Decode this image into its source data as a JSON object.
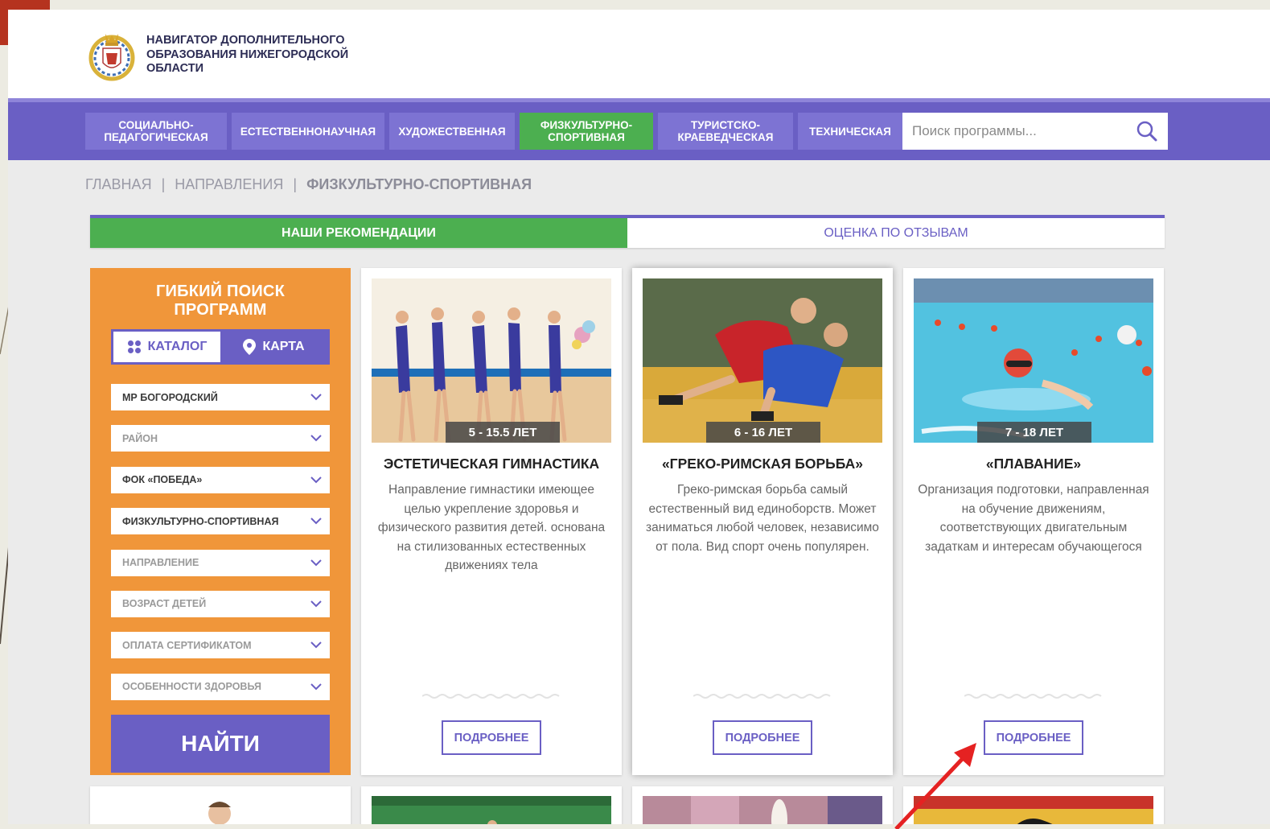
{
  "header": {
    "logo_text": "НАВИГАТОР ДОПОЛНИТЕЛЬНОГО ОБРАЗОВАНИЯ НИЖЕГОРОДСКОЙ ОБЛАСТИ"
  },
  "nav": {
    "tabs": [
      {
        "label": "СОЦИАЛЬНО-ПЕДАГОГИЧЕСКАЯ"
      },
      {
        "label": "ЕСТЕСТВЕННОНАУЧНАЯ"
      },
      {
        "label": "ХУДОЖЕСТВЕННАЯ"
      },
      {
        "label": "ФИЗКУЛЬТУРНО-СПОРТИВНАЯ"
      },
      {
        "label": "ТУРИСТСКО-КРАЕВЕДЧЕСКАЯ"
      },
      {
        "label": "ТЕХНИЧЕСКАЯ"
      }
    ],
    "active_index": 3,
    "search_placeholder": "Поиск программы..."
  },
  "breadcrumb": {
    "items": [
      "ГЛАВНАЯ",
      "НАПРАВЛЕНИЯ",
      "ФИЗКУЛЬТУРНО-СПОРТИВНАЯ"
    ],
    "separator": "|"
  },
  "rec_tabs": {
    "recommendations": "НАШИ РЕКОМЕНДАЦИИ",
    "reviews": "ОЦЕНКА ПО ОТЗЫВАМ"
  },
  "sidebar": {
    "title": "ГИБКИЙ ПОИСК ПРОГРАММ",
    "catalog_label": "КАТАЛОГ",
    "map_label": "КАРТА",
    "filters": [
      {
        "label": "МР БОГОРОДСКИЙ",
        "filled": true
      },
      {
        "label": "РАЙОН",
        "filled": false
      },
      {
        "label": "ФОК «ПОБЕДА»",
        "filled": true
      },
      {
        "label": "ФИЗКУЛЬТУРНО-СПОРТИВНАЯ",
        "filled": true
      },
      {
        "label": "НАПРАВЛЕНИЕ",
        "filled": false
      },
      {
        "label": "ВОЗРАСТ ДЕТЕЙ",
        "filled": false
      },
      {
        "label": "ОПЛАТА СЕРТИФИКАТОМ",
        "filled": false
      },
      {
        "label": "ОСОБЕННОСТИ ЗДОРОВЬЯ",
        "filled": false
      }
    ],
    "find_label": "НАЙТИ"
  },
  "cards": [
    {
      "age": "5 - 15.5 ЛЕТ",
      "title": "ЭСТЕТИЧЕСКАЯ ГИМНАСТИКА",
      "description": "Направление гимнастики имеющее целью укрепление здоровья и физического развития детей. основана на стилизованных естественных движениях тела",
      "button": "ПОДРОБНЕЕ"
    },
    {
      "age": "6 - 16 ЛЕТ",
      "title": "«ГРЕКО-РИМСКАЯ БОРЬБА»",
      "description": "Греко-римская борьба самый естественный вид единоборств. Может заниматься любой человек, независимо от пола. Вид спорт очень популярен.",
      "button": "ПОДРОБНЕЕ"
    },
    {
      "age": "7 - 18 ЛЕТ",
      "title": "«ПЛАВАНИЕ»",
      "description": "Организация подготовки, направленная на обучение движениям, соответствующих двигательным задаткам и интересам обучающегося",
      "button": "ПОДРОБНЕЕ"
    }
  ],
  "colors": {
    "primary": "#6a5fc4",
    "active_green": "#4caf50",
    "sidebar_orange": "#f0963a",
    "annotation_red": "#e52222"
  },
  "icons": {
    "search": "search-icon",
    "catalog": "grid-icon",
    "map": "map-pin-icon",
    "chevron": "chevron-down-icon",
    "emblem": "coat-of-arms-icon"
  }
}
